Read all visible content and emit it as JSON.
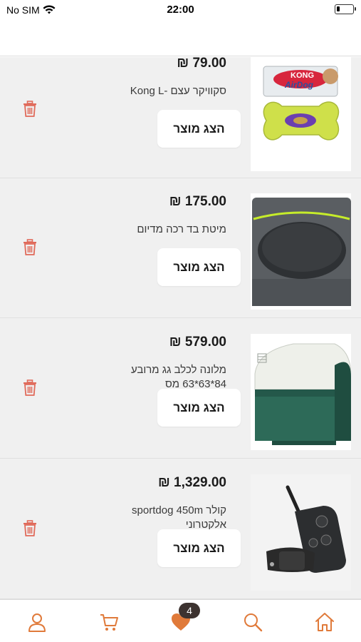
{
  "status_bar": {
    "carrier": "No SIM",
    "time": "22:00"
  },
  "colors": {
    "accent": "#e07a3a",
    "trash": "#e06a5a",
    "list_background": "#f0f0f0",
    "badge": "#3d3330"
  },
  "products": [
    {
      "price": "79.00 ₪",
      "name": "סקוויקר עצם -Kong L",
      "button_label": "הצג מוצר",
      "image": "kong-airdog-bone-toy"
    },
    {
      "price": "175.00 ₪",
      "name": "מיטת בד רכה מדיום",
      "button_label": "הצג מוצר",
      "image": "soft-dog-bed"
    },
    {
      "price": "579.00 ₪",
      "name": "מלונה לכלב גג מרובע 84*63*63 מס",
      "button_label": "הצג מוצר",
      "image": "dog-house"
    },
    {
      "price": "1,329.00 ₪",
      "name": "קולר sportdog 450m אלקטרוני",
      "button_label": "הצג מוצר",
      "image": "electronic-collar"
    }
  ],
  "bottom_nav": {
    "items": [
      "profile-icon",
      "cart-icon",
      "wishlist-icon",
      "search-icon",
      "home-icon"
    ],
    "wishlist_count": "4"
  }
}
